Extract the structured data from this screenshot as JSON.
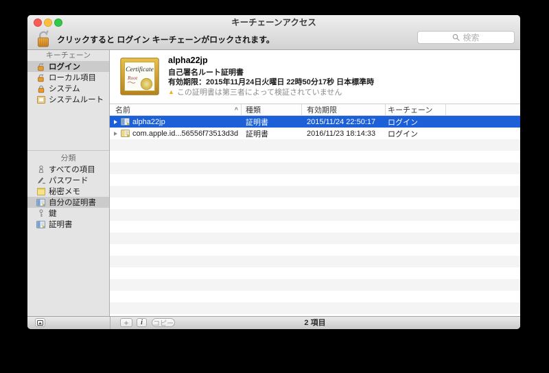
{
  "window": {
    "title": "キーチェーンアクセス"
  },
  "toolbar": {
    "lock_message": "クリックすると ログイン キーチェーンがロックされます。",
    "search_placeholder": "検索"
  },
  "sidebar": {
    "sections": [
      {
        "header": "キーチェーン",
        "items": [
          {
            "label": "ログイン",
            "icon": "lock-open-icon",
            "selected": true
          },
          {
            "label": "ローカル項目",
            "icon": "lock-open-icon",
            "selected": false
          },
          {
            "label": "システム",
            "icon": "lock-closed-icon",
            "selected": false
          },
          {
            "label": "システムルート",
            "icon": "system-root-icon",
            "selected": false
          }
        ]
      },
      {
        "header": "分類",
        "items": [
          {
            "label": "すべての項目",
            "icon": "all-items-icon",
            "selected": false
          },
          {
            "label": "パスワード",
            "icon": "password-icon",
            "selected": false
          },
          {
            "label": "秘密メモ",
            "icon": "secure-note-icon",
            "selected": false
          },
          {
            "label": "自分の証明書",
            "icon": "my-certificates-icon",
            "selected": true
          },
          {
            "label": "鍵",
            "icon": "key-icon",
            "selected": false
          },
          {
            "label": "証明書",
            "icon": "certificate-icon",
            "selected": false
          }
        ]
      }
    ]
  },
  "detail": {
    "name": "alpha22jp",
    "kind": "自己署名ルート証明書",
    "expiry": "有効期限：2015年11月24日火曜日 22時50分17秒 日本標準時",
    "warning": "この証明書は第三者によって検証されていません",
    "warning_glyph": "▲"
  },
  "table": {
    "columns": [
      "名前",
      "種類",
      "有効期限",
      "キーチェーン"
    ],
    "sort_glyph": "^",
    "rows": [
      {
        "name": "alpha22jp",
        "kind": "証明書",
        "expires": "2015/11/24 22:50:17",
        "keychain": "ログイン",
        "selected": true
      },
      {
        "name": "com.apple.id...56556f73513d3d",
        "kind": "証明書",
        "expires": "2016/11/23 18:14:33",
        "keychain": "ログイン",
        "selected": false
      }
    ]
  },
  "statusbar": {
    "add_label": "+",
    "info_label": "i",
    "copy_label": "コピー",
    "count": "2 項目"
  },
  "colors": {
    "selection_blue": "#1b60d8",
    "sidebar_selection": "#cbcbcb",
    "warning_amber": "#edb21b",
    "traffic_red": "#fc5c56",
    "traffic_yellow": "#fdbe41",
    "traffic_green": "#35c749"
  }
}
